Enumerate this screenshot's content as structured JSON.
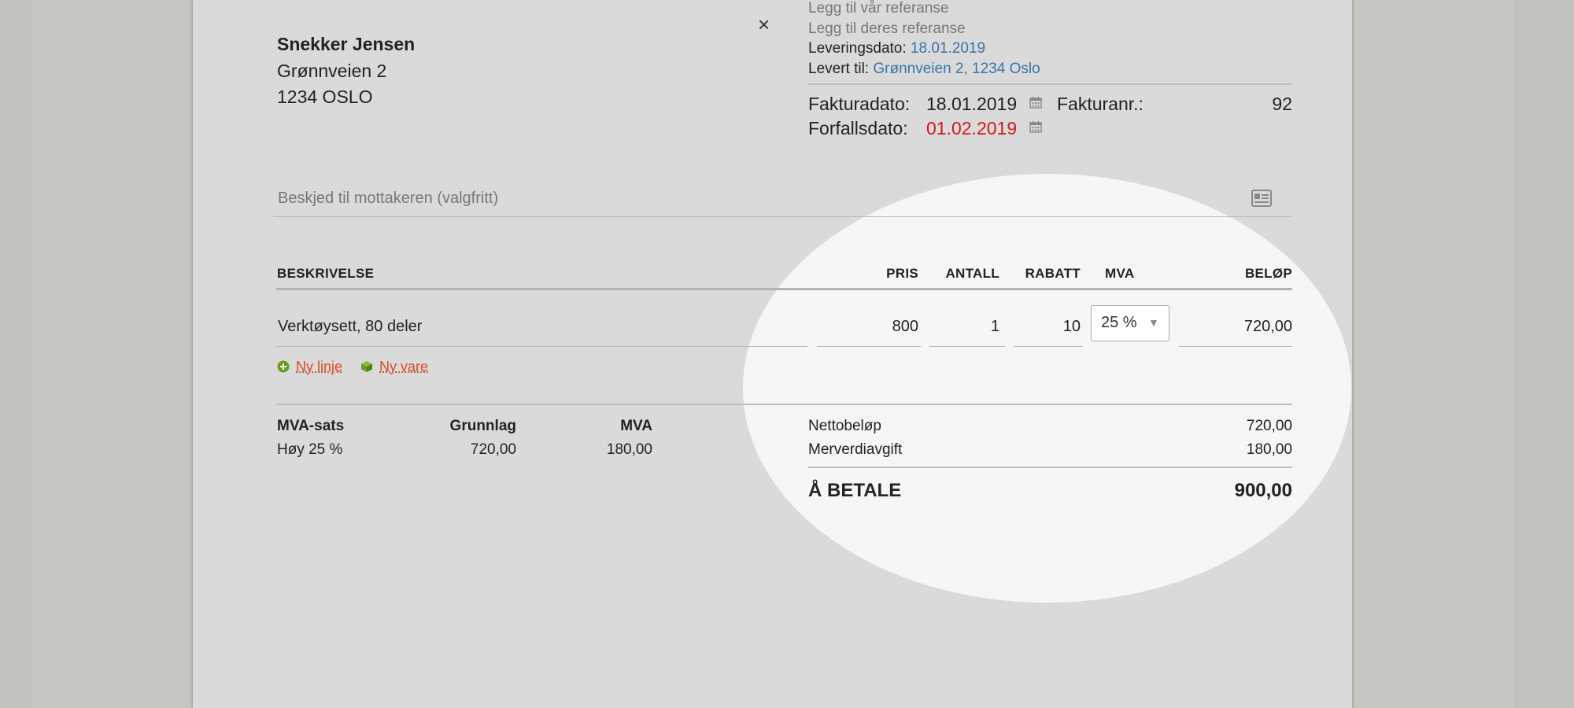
{
  "customer": {
    "name": "Snekker Jensen",
    "street": "Grønnveien 2",
    "city": "1234 OSLO"
  },
  "close_label": "×",
  "references": {
    "our_ref": "Legg til vår referanse",
    "their_ref": "Legg til deres referanse",
    "delivery_date_label": "Leveringsdato:",
    "delivery_date": "18.01.2019",
    "delivered_to_label": "Levert til:",
    "delivered_to": "Grønnveien 2, 1234 Oslo"
  },
  "invoice": {
    "date_label": "Fakturadato:",
    "date": "18.01.2019",
    "number_label": "Fakturanr.:",
    "number": "92",
    "due_label": "Forfallsdato:",
    "due": "01.02.2019",
    "due_color": "#d41818"
  },
  "message": {
    "placeholder": "Beskjed til mottakeren (valgfritt)"
  },
  "table": {
    "headers": {
      "description": "BESKRIVELSE",
      "price": "PRIS",
      "qty": "ANTALL",
      "discount": "RABATT",
      "vat": "MVA",
      "amount": "BELØP"
    },
    "rows": [
      {
        "description": "Verktøysett, 80 deler",
        "price": "800",
        "qty": "1",
        "discount": "10",
        "vat": "25 %",
        "amount": "720,00"
      }
    ]
  },
  "actions": {
    "new_line": "Ny linje",
    "new_item": "Ny vare"
  },
  "vat_summary": {
    "headers": {
      "rate": "MVA-sats",
      "base": "Grunnlag",
      "vat": "MVA"
    },
    "rows": [
      {
        "rate": "Høy 25 %",
        "base": "720,00",
        "vat": "180,00"
      }
    ]
  },
  "totals": {
    "net_label": "Nettobeløp",
    "net": "720,00",
    "vat_label": "Merverdiavgift",
    "vat": "180,00",
    "pay_label": "Å BETALE",
    "pay": "900,00"
  },
  "colors": {
    "link": "#3a73a6",
    "action": "#d84a24",
    "icon_green": "#6a9a1f"
  }
}
